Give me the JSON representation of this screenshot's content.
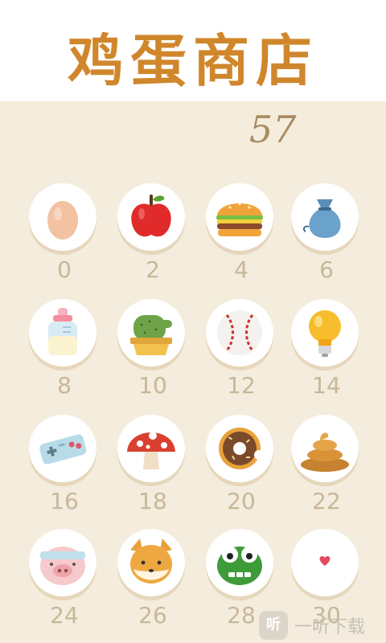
{
  "header": {
    "title": "鸡蛋商店"
  },
  "balance": {
    "value": "57"
  },
  "colors": {
    "title": "#d0872c",
    "price": "#c8b79a",
    "background": "#f4ecdc"
  },
  "items": [
    {
      "icon": "egg-icon",
      "price": "0"
    },
    {
      "icon": "apple-icon",
      "price": "2"
    },
    {
      "icon": "burger-icon",
      "price": "4"
    },
    {
      "icon": "sack-icon",
      "price": "6"
    },
    {
      "icon": "baby-bottle-icon",
      "price": "8"
    },
    {
      "icon": "cactus-icon",
      "price": "10"
    },
    {
      "icon": "baseball-icon",
      "price": "12"
    },
    {
      "icon": "light-bulb-icon",
      "price": "14"
    },
    {
      "icon": "game-controller-icon",
      "price": "16"
    },
    {
      "icon": "mushroom-icon",
      "price": "18"
    },
    {
      "icon": "donut-icon",
      "price": "20"
    },
    {
      "icon": "poop-icon",
      "price": "22"
    },
    {
      "icon": "pig-icon",
      "price": "24"
    },
    {
      "icon": "shiba-dog-icon",
      "price": "26"
    },
    {
      "icon": "frog-icon",
      "price": "28"
    },
    {
      "icon": "heart-icon",
      "price": "30"
    }
  ],
  "watermark": {
    "badge": "听",
    "text": "一听下载"
  }
}
